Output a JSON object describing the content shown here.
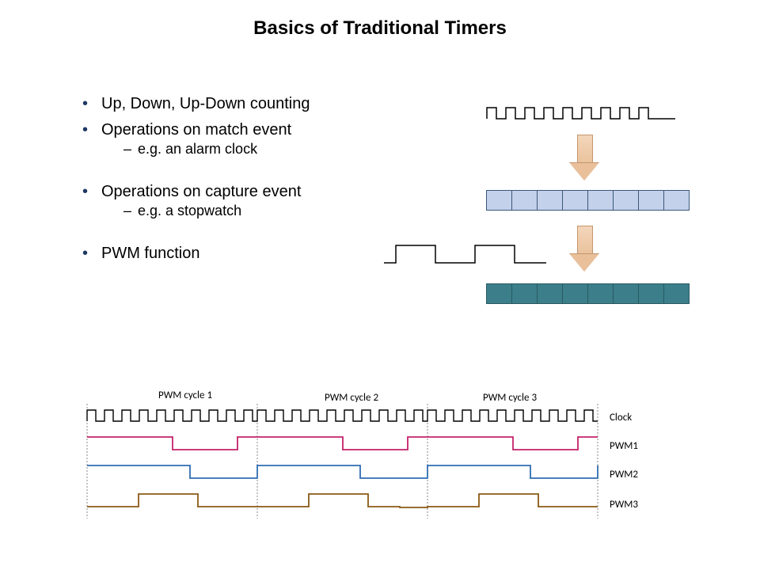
{
  "title": "Basics of Traditional Timers",
  "bullets": {
    "b1": "Up, Down, Up-Down counting",
    "b2": "Operations on match event",
    "b2a": "e.g. an alarm clock",
    "b3": "Operations on capture event",
    "b3a": "e.g. a stopwatch",
    "b4": "PWM function"
  },
  "pwm": {
    "cycle1": "PWM cycle 1",
    "cycle2": "PWM cycle 2",
    "cycle3": "PWM cycle 3",
    "clock": "Clock",
    "row1": "PWM1",
    "row2": "PWM2",
    "row3": "PWM3"
  },
  "colors": {
    "pwm1": "#c4226a",
    "pwm2": "#2f6db3",
    "pwm3": "#8a5a16",
    "lightcell": "#c3d1ea",
    "darkcell": "#3c7f8b",
    "arrow": "#eac29c"
  },
  "chart_data": {
    "type": "line",
    "title": "PWM timing diagram (3 cycles of a shared clock, 3 PWM outputs with different duty cycles)",
    "clock_ticks_per_cycle": 10,
    "cycles": 3,
    "signals": [
      {
        "name": "Clock",
        "type": "square_clock",
        "periods": 30
      },
      {
        "name": "PWM1",
        "duty_high_fraction_per_cycle": 0.5,
        "phase_start": "high"
      },
      {
        "name": "PWM2",
        "duty_high_fraction_per_cycle": 0.6,
        "phase_start": "high"
      },
      {
        "name": "PWM3",
        "duty_high_fraction_per_cycle": 0.3,
        "phase_start": "low"
      }
    ],
    "upper_diagram": {
      "description": "Fast clock feeds an 8-cell counter/register; a slower derived waveform then feeds a second 8-cell register",
      "register_width_cells": 8
    }
  }
}
